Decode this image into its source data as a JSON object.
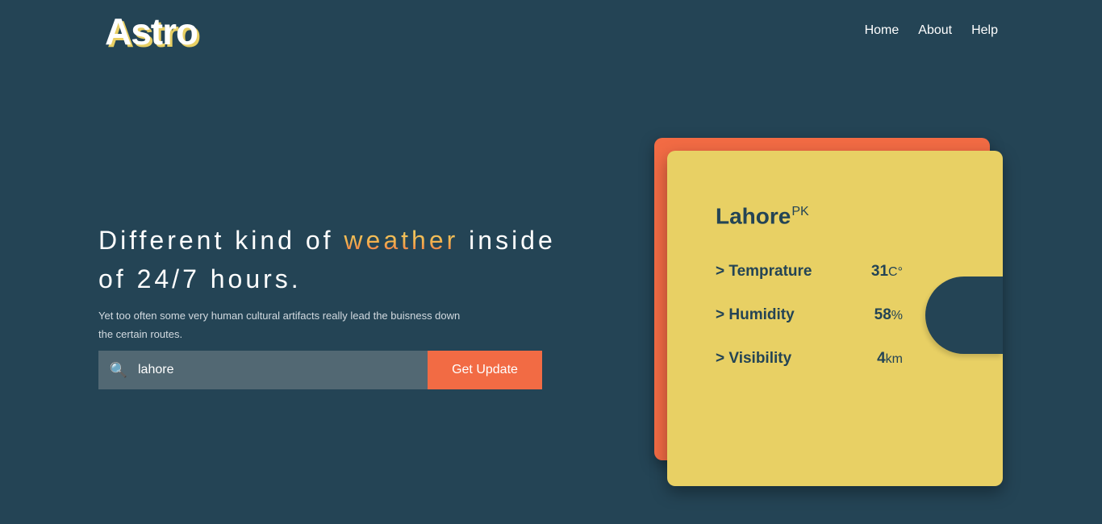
{
  "brand": {
    "name": "Astro"
  },
  "nav": {
    "items": [
      "Home",
      "About",
      "Help"
    ]
  },
  "hero": {
    "headline_prefix": "Different kind of",
    "headline_accent": "weather",
    "headline_suffix": "inside of 24/7 hours.",
    "description": "Yet too often some very human cultural artifacts really lead the buisness down the certain routes."
  },
  "search": {
    "icon": "search-icon",
    "value": "lahore",
    "button_label": "Get Update"
  },
  "weather_card": {
    "city": "Lahore",
    "country": "PK",
    "metrics": [
      {
        "label": "> Temprature",
        "value": "31",
        "unit": "C°"
      },
      {
        "label": "> Humidity",
        "value": "58",
        "unit": "%"
      },
      {
        "label": "> Visibility",
        "value": "4",
        "unit": "km"
      }
    ]
  },
  "colors": {
    "background": "#244455",
    "accent_orange": "#f26b44",
    "accent_yellow": "#e8d064",
    "search_bg": "#526873"
  }
}
